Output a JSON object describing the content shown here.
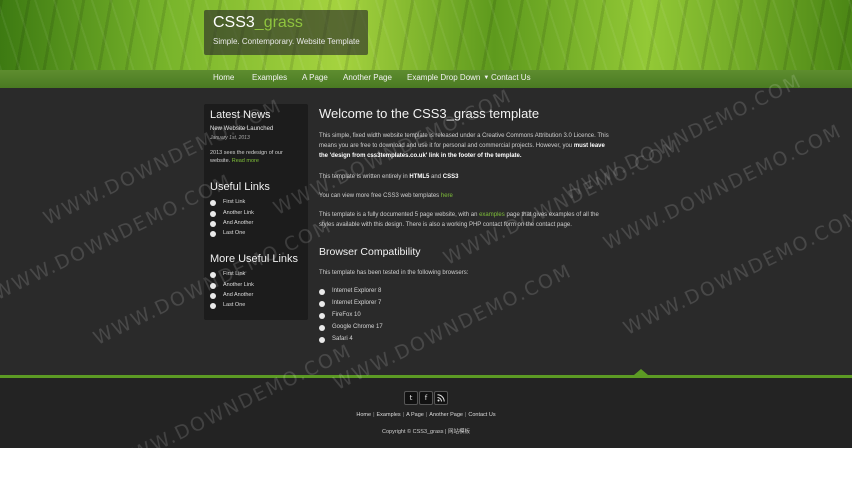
{
  "header": {
    "logo_title": "CSS3",
    "logo_title_accent": "_grass",
    "tagline": "Simple. Contemporary. Website Template"
  },
  "nav": {
    "items": [
      "Home",
      "Examples",
      "A Page",
      "Another Page",
      "Example Drop Down",
      "Contact Us"
    ]
  },
  "sidebar": {
    "latest_news": {
      "heading": "Latest News",
      "title": "New Website Launched",
      "date": "January 1st, 2013",
      "text_line1": "2013 sees the redesign of our",
      "text_line2": "website.",
      "read_more": "Read more"
    },
    "useful_links": {
      "heading": "Useful Links",
      "items": [
        "First Link",
        "Another Link",
        "And Another",
        "Last One"
      ]
    },
    "more_useful_links": {
      "heading": "More Useful Links",
      "items": [
        "First Link",
        "Another Link",
        "And Another",
        "Last One"
      ]
    }
  },
  "main": {
    "title": "Welcome to the CSS3_grass template",
    "p1_line1": "This simple, fixed width website template is released under a Creative Commons Attribution 3.0 Licence. This",
    "p1_line2": "means you are free to download and use it for personal and commercial projects. However, you",
    "p1_bold1": "must leave",
    "p1_bold2": "the 'design from css3templates.co.uk' link in the footer of the template.",
    "p2_text": "This template is written entirely in",
    "p2_html5": "HTML5",
    "p2_and": "and",
    "p2_css3": "CSS3",
    "p3_text": "You can view more free CSS3 web templates",
    "p3_link": "here",
    "p4_line1a": "This template is a fully documented 5 page website, with an",
    "p4_link": "examples",
    "p4_line1b": "page that gives examples of all the",
    "p4_line2": "styles available with this design. There is also a working PHP contact form on the contact page.",
    "compat_heading": "Browser Compatibility",
    "compat_text": "This template has been tested in the following browsers:",
    "browsers": [
      "Internet Explorer 8",
      "Internet Explorer 7",
      "FireFox 10",
      "Google Chrome 17",
      "Safari 4"
    ]
  },
  "footer": {
    "social_icons": [
      "twitter-icon",
      "facebook-icon",
      "rss-icon"
    ],
    "social_glyphs": [
      "t",
      "f",
      "⟟"
    ],
    "links": [
      "Home",
      "Examples",
      "A Page",
      "Another Page",
      "Contact Us"
    ],
    "link_separator": "|",
    "copyright": "Copyright © CSS3_grass | 网站模板"
  },
  "watermark": "WWW.DOWNDEMO.COM",
  "colors": {
    "accent_green": "#7fbf3a",
    "nav_green": "#4a7a22",
    "content_bg": "#2a2a2a",
    "sidebar_bg": "#1c1c1c"
  }
}
